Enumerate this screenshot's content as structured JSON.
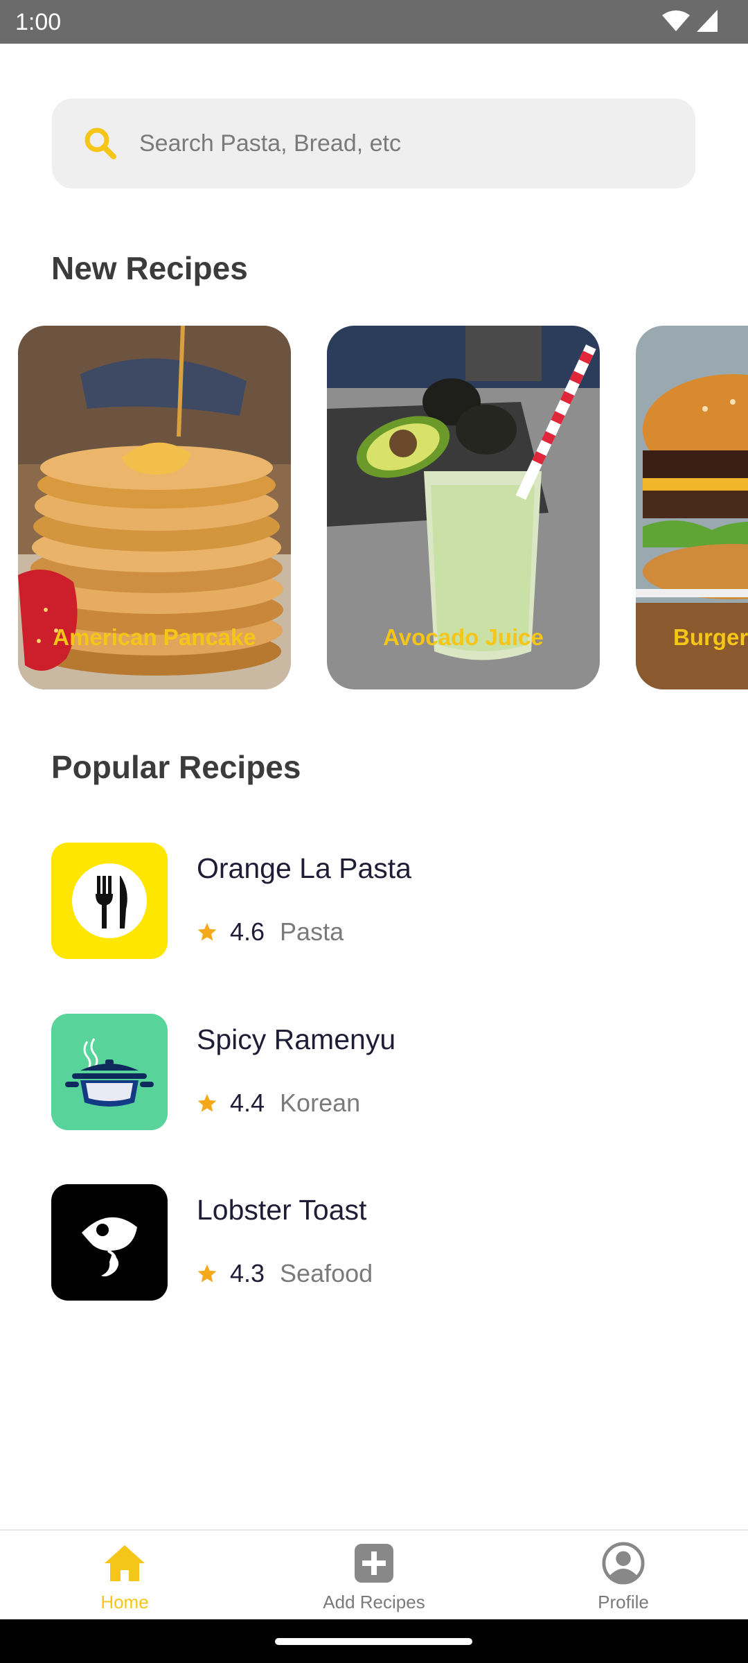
{
  "status_bar": {
    "time": "1:00"
  },
  "search": {
    "placeholder": "Search Pasta, Bread, etc"
  },
  "new_recipes": {
    "title": "New Recipes",
    "cards": [
      {
        "label": "American Pancake"
      },
      {
        "label": "Avocado Juice"
      },
      {
        "label": "Burger"
      }
    ]
  },
  "popular_recipes": {
    "title": "Popular Recipes",
    "items": [
      {
        "name": "Orange La Pasta",
        "rating": "4.6",
        "category": "Pasta",
        "icon": "fork-knife-icon",
        "color": "#FFE600"
      },
      {
        "name": "Spicy Ramenyu",
        "rating": "4.4",
        "category": "Korean",
        "icon": "cooking-pot-icon",
        "color": "#58D39A"
      },
      {
        "name": "Lobster Toast",
        "rating": "4.3",
        "category": "Seafood",
        "icon": "fish-icon",
        "color": "#000000"
      }
    ]
  },
  "bottom_nav": {
    "items": [
      {
        "label": "Home",
        "icon": "home-icon",
        "active": true
      },
      {
        "label": "Add Recipes",
        "icon": "plus-square-icon",
        "active": false
      },
      {
        "label": "Profile",
        "icon": "profile-icon",
        "active": false
      }
    ]
  },
  "colors": {
    "accent": "#F5C518",
    "star": "#F4A81C",
    "text_dark": "#1F1D36",
    "text_muted": "#7A7A7A"
  }
}
